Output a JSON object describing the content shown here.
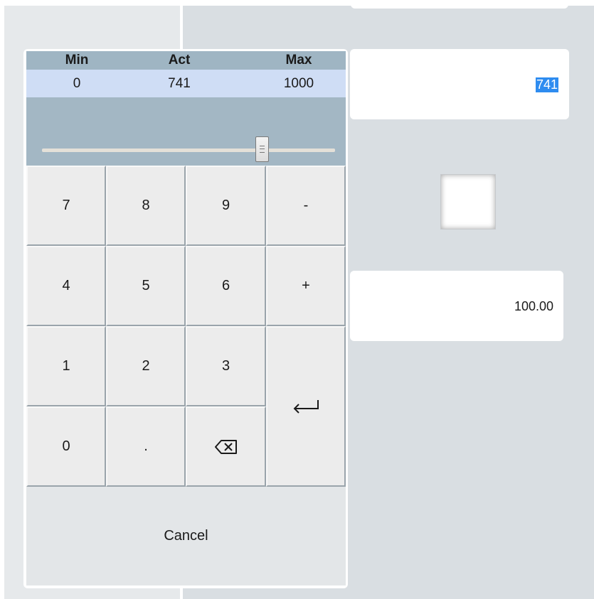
{
  "range": {
    "min_label": "Min",
    "act_label": "Act",
    "max_label": "Max",
    "min_value": "0",
    "act_value": "741",
    "max_value": "1000"
  },
  "slider": {
    "value": 741,
    "min": 0,
    "max": 1000
  },
  "keypad": {
    "keys": {
      "k7": "7",
      "k8": "8",
      "k9": "9",
      "minus": "-",
      "k4": "4",
      "k5": "5",
      "k6": "6",
      "plus": "+",
      "k1": "1",
      "k2": "2",
      "k3": "3",
      "k0": "0",
      "dot": "."
    },
    "enter_icon": "enter-return-icon",
    "backspace_icon": "backspace-icon",
    "cancel_label": "Cancel"
  },
  "right_panel": {
    "selected_value": "741",
    "numeric_value": "100.00",
    "checkbox_checked": false
  },
  "colors": {
    "header_bg": "#9fb5c3",
    "values_bg": "#cfddf5",
    "selection": "#2e8cf0"
  }
}
